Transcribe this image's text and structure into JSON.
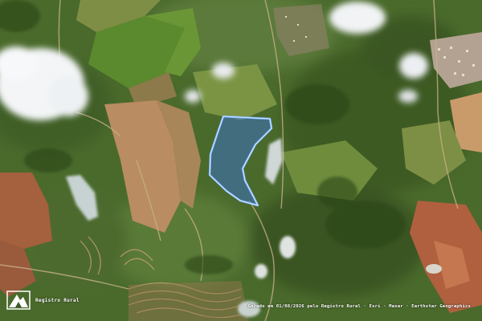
{
  "watermark": {
    "brand": "Registro Rural",
    "logo_icon": "registro-rural-logo"
  },
  "attribution": "Gerado em 01/08/2026 pelo Registro Rural · Esri · Maxar · Earthstar Geographics",
  "parcel": {
    "fill_color": "#3b6fc4",
    "outline_color": "#7fb4ff"
  },
  "colors": {
    "vegetation_dark": "#2f4a1f",
    "vegetation": "#4c6b2e",
    "pasture": "#8a9a4c",
    "bare_soil": "#b98a5f",
    "red_soil": "#a0523a",
    "cloud": "#f4f6f8",
    "urban": "#b8a79a"
  }
}
